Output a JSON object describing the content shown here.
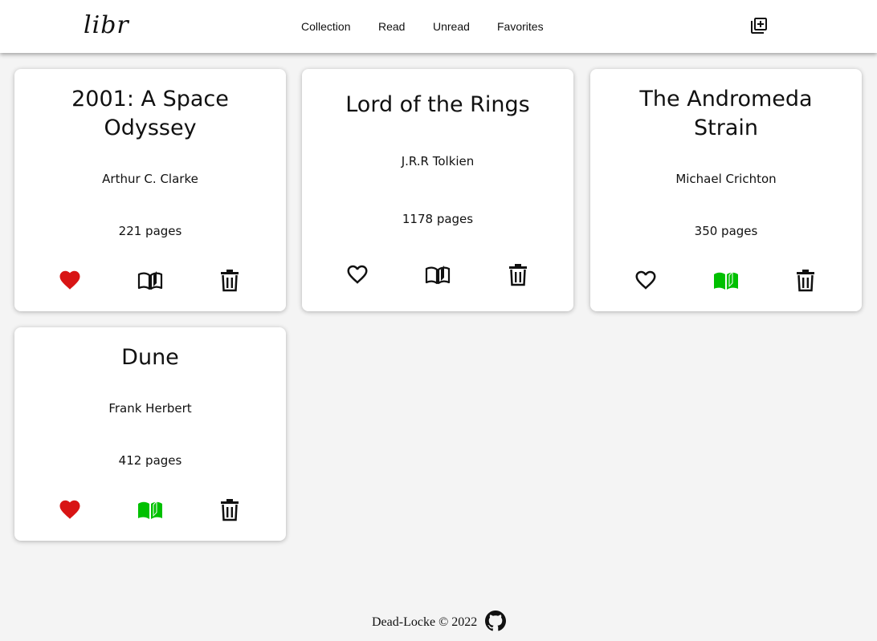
{
  "app": {
    "logo": "libr"
  },
  "nav": {
    "items": [
      "Collection",
      "Read",
      "Unread",
      "Favorites"
    ]
  },
  "header": {
    "add_icon": "library-add-icon"
  },
  "books": [
    {
      "title": "2001: A Space Odyssey",
      "author": "Arthur C. Clarke",
      "pages": "221 pages",
      "favorite": true,
      "read": false
    },
    {
      "title": "Lord of the Rings",
      "author": "J.R.R Tolkien",
      "pages": "1178 pages",
      "favorite": false,
      "read": false
    },
    {
      "title": "The Andromeda Strain",
      "author": "Michael Crichton",
      "pages": "350 pages",
      "favorite": false,
      "read": true
    },
    {
      "title": "Dune",
      "author": "Frank Herbert",
      "pages": "412 pages",
      "favorite": true,
      "read": true
    }
  ],
  "colors": {
    "favorite": "#d81414",
    "read": "#00c000",
    "inactive": "#111111",
    "background": "#f4f4f4"
  },
  "footer": {
    "copyright": "Dead-Locke © 2022",
    "icon": "github-icon"
  }
}
